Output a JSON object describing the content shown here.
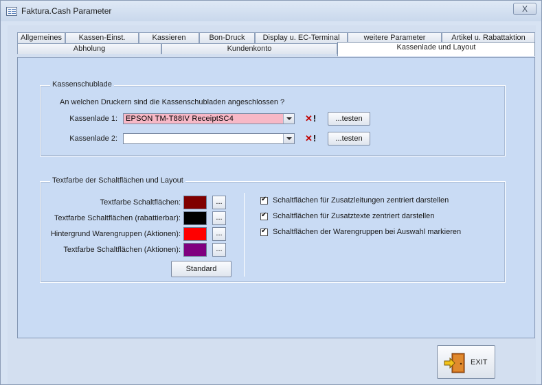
{
  "window": {
    "title": "Faktura.Cash Parameter",
    "close_label": "X"
  },
  "tabs_row1": [
    {
      "label": "Allgemeines"
    },
    {
      "label": "Kassen-Einst."
    },
    {
      "label": "Kassieren"
    },
    {
      "label": "Bon-Druck"
    },
    {
      "label": "Display u. EC-Terminal"
    },
    {
      "label": "weitere Parameter"
    },
    {
      "label": "Artikel u. Rabattaktion"
    }
  ],
  "tabs_row2": [
    {
      "label": "Abholung"
    },
    {
      "label": "Kundenkonto"
    },
    {
      "label": "Kassenlade und Layout",
      "active": true
    }
  ],
  "drawer_group": {
    "title": "Kassenschublade",
    "question": "An welchen Druckern sind die Kassenschubladen angeschlossen ?",
    "drawers": [
      {
        "label": "Kassenlade 1:",
        "value": "EPSON TM-T88IV ReceiptSC4",
        "color": "#f7b8c6",
        "test_label": "...testen",
        "clear_icon": "clear-x-icon"
      },
      {
        "label": "Kassenlade 2:",
        "value": "",
        "color": "#ffffff",
        "test_label": "...testen",
        "clear_icon": "clear-x-icon"
      }
    ]
  },
  "layout_group": {
    "title": "Textfarbe der Schaltflächen und Layout",
    "colors": [
      {
        "label": "Textfarbe Schaltflächen:",
        "color": "#800000",
        "button": "..."
      },
      {
        "label": "Textfarbe Schaltflächen (rabattierbar):",
        "color": "#000000",
        "button": "..."
      },
      {
        "label": "Hintergrund Warengruppen (Aktionen):",
        "color": "#ff0000",
        "button": "..."
      },
      {
        "label": "Textfarbe Schaltflächen (Aktionen):",
        "color": "#800080",
        "button": "..."
      }
    ],
    "standard_label": "Standard",
    "checkboxes": [
      {
        "label": "Schaltflächen für Zusatzleitungen zentriert darstellen",
        "checked": true
      },
      {
        "label": "Schaltflächen für Zusatztexte zentriert darstellen",
        "checked": true
      },
      {
        "label": "Schaltflächen der Warengruppen bei Auswahl markieren",
        "checked": true
      }
    ]
  },
  "footer": {
    "exit_label": "EXIT",
    "exit_icon": "door-exit-icon"
  }
}
